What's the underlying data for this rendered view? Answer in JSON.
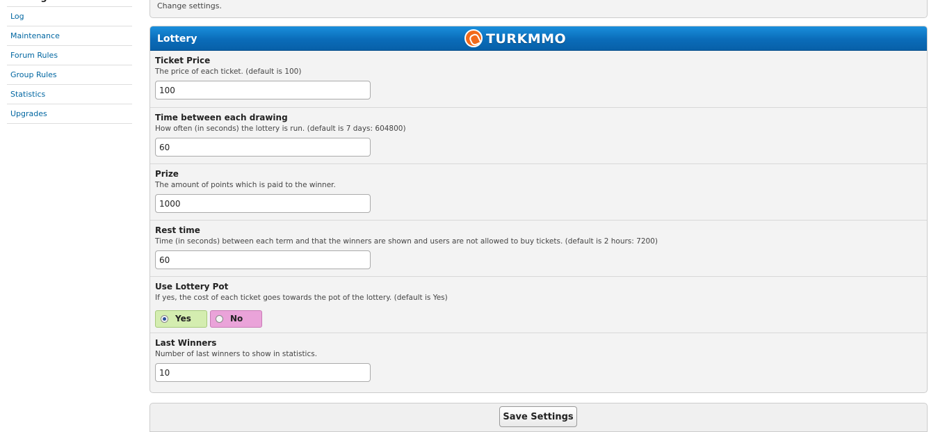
{
  "sidebar": {
    "heading": "Settings",
    "items": [
      {
        "label": "Log"
      },
      {
        "label": "Maintenance"
      },
      {
        "label": "Forum Rules"
      },
      {
        "label": "Group Rules"
      },
      {
        "label": "Statistics"
      },
      {
        "label": "Upgrades"
      }
    ]
  },
  "top_box": {
    "description": "Change settings."
  },
  "panel": {
    "title": "Lottery",
    "logo_text": "TURKMMO",
    "fields": [
      {
        "label": "Ticket Price",
        "help": "The price of each ticket. (default is 100)",
        "value": "100"
      },
      {
        "label": "Time between each drawing",
        "help": "How often (in seconds) the lottery is run. (default is 7 days: 604800)",
        "value": "60"
      },
      {
        "label": "Prize",
        "help": "The amount of points which is paid to the winner.",
        "value": "1000"
      },
      {
        "label": "Rest time",
        "help": "Time (in seconds) between each term and that the winners are shown and users are not allowed to buy tickets. (default is 2 hours: 7200)",
        "value": "60"
      }
    ],
    "pot": {
      "label": "Use Lottery Pot",
      "help": "If yes, the cost of each ticket goes towards the pot of the lottery. (default is Yes)",
      "yes_label": "Yes",
      "no_label": "No",
      "selected": "Yes"
    },
    "last_winners": {
      "label": "Last Winners",
      "help": "Number of last winners to show in statistics.",
      "value": "10"
    }
  },
  "footer": {
    "save_label": "Save Settings"
  },
  "colors": {
    "header_blue": "#0a6cb9",
    "link_blue": "#0066a1",
    "yes_green": "#d4edb0",
    "no_pink": "#eaa3d9",
    "logo_orange": "#f26a1b"
  }
}
